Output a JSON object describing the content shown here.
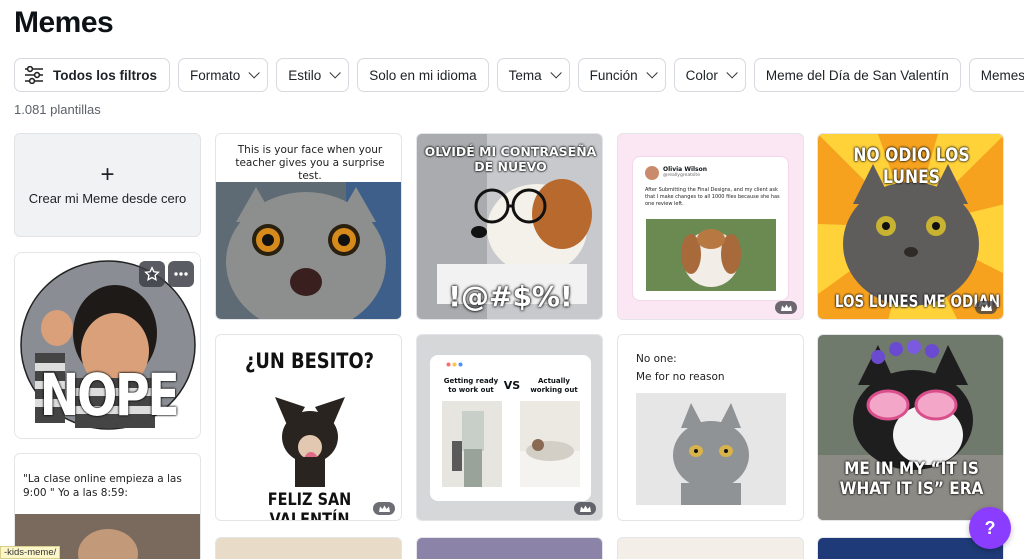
{
  "page": {
    "title": "Memes"
  },
  "filters": {
    "all_filters": "Todos los filtros",
    "items": [
      "Formato",
      "Estilo",
      "Solo en mi idioma",
      "Tema",
      "Función",
      "Color",
      "Meme del Día de San Valentín",
      "Memes de"
    ]
  },
  "results": {
    "count": "1.081 plantillas"
  },
  "create": {
    "plus": "+",
    "label": "Crear mi Meme desde cero"
  },
  "templates": {
    "cat_test": "This is your face when your teacher gives you a surprise test.",
    "dog_password_top": "OLVIDÉ MI CONTRASEÑA DE NUEVO",
    "dog_password_bottom": "!@#$%!",
    "tweet_name": "Olivia Wilson",
    "tweet_handle": "@reallygreatsite",
    "tweet_text": "After Submitting the Final Designs, and my client ask that I make changes to all 1000 files because she has one review left.",
    "mondays_top": "NO ODIO LOS LUNES",
    "mondays_bottom": "LOS LUNES ME ODIAN A MÍ",
    "nope": "NOPE",
    "besito_top": "¿UN BESITO?",
    "besito_bottom": "FELIZ SAN VALENTÍN",
    "gym_left": "Getting ready to work out",
    "gym_vs": "VS",
    "gym_right": "Actually working out",
    "noone_1": "No one:",
    "noone_2": "Me for no reason",
    "era_text": "ME IN MY “IT IS WHAT IT IS” ERA",
    "online_class": "\"La clase online empieza a las 9:00 \" Yo a las 8:59:"
  },
  "help": {
    "label": "?"
  },
  "status_url": "-kids-meme/",
  "icons": [
    "sliders-icon",
    "chevron-down-icon",
    "crown-icon",
    "star-icon",
    "more-icon"
  ],
  "colors": {
    "accent": "#8b3dff",
    "chip_border": "#d6d9de",
    "crown_badge": "#3c3c46"
  }
}
